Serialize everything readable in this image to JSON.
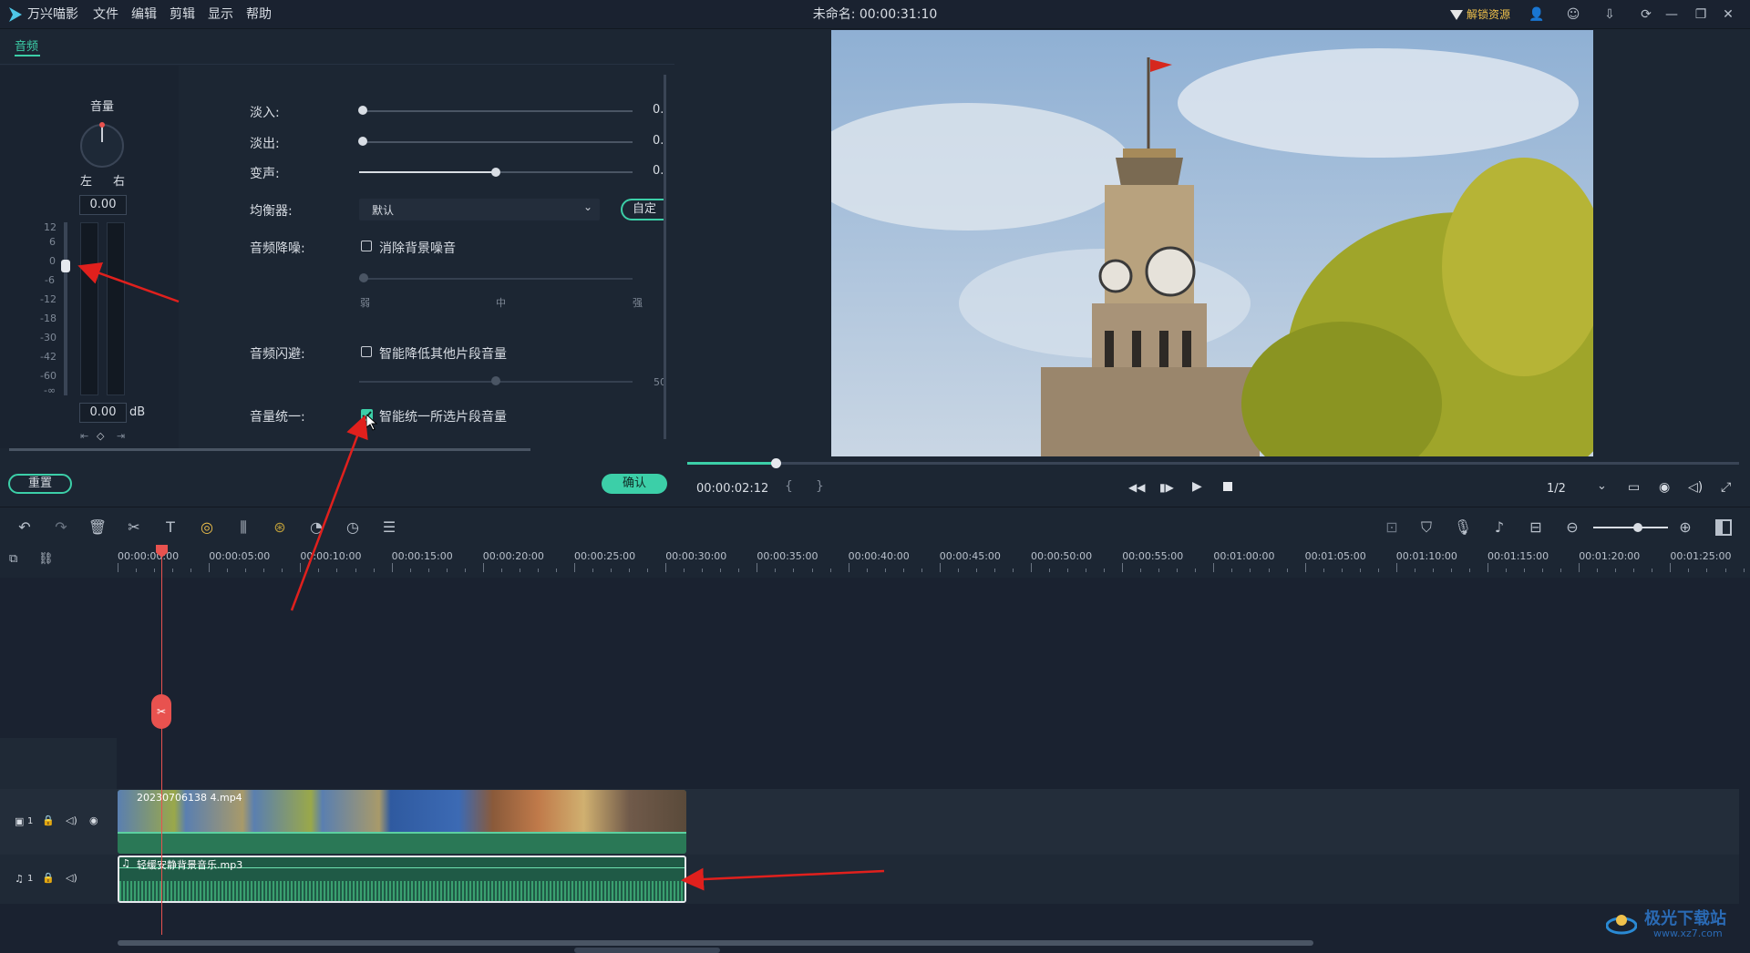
{
  "app": {
    "name": "万兴喵影",
    "title": "未命名: 00:00:31:10",
    "unlock_label": "解锁资源"
  },
  "menu": [
    "文件",
    "编辑",
    "剪辑",
    "显示",
    "帮助"
  ],
  "panel": {
    "tab": "音频",
    "volume_label": "音量",
    "left_label": "左",
    "right_label": "右",
    "pan_value": "0.00",
    "meter_scale": [
      "12",
      "6",
      "0",
      "-6",
      "-12",
      "-18",
      "-30",
      "-42",
      "-60",
      "-∞"
    ],
    "volume_value": "0.00",
    "db_unit": "dB",
    "fade_in_label": "淡入:",
    "fade_out_label": "淡出:",
    "pitch_label": "变声:",
    "eq_label": "均衡器:",
    "eq_value": "默认",
    "eq_custom": "自定",
    "denoise_label": "音频降噪:",
    "denoise_check": "消除背景噪音",
    "denoise_low": "弱",
    "denoise_mid": "中",
    "denoise_high": "强",
    "ducking_label": "音频闪避:",
    "ducking_check": "智能降低其他片段音量",
    "ducking_value": "50",
    "normalize_label": "音量统一:",
    "normalize_check": "智能统一所选片段音量",
    "normalize_checked": true,
    "value_truncated": "0.",
    "reset_button": "重置",
    "ok_button": "确认"
  },
  "preview": {
    "time": "00:00:02:12",
    "bracket_in": "{",
    "bracket_out": "}",
    "quality": "1/2",
    "progress": 0.084
  },
  "ruler": [
    "00:00:00:00",
    "00:00:05:00",
    "00:00:10:00",
    "00:00:15:00",
    "00:00:20:00",
    "00:00:25:00",
    "00:00:30:00",
    "00:00:35:00",
    "00:00:40:00",
    "00:00:45:00",
    "00:00:50:00",
    "00:00:55:00",
    "00:01:00:00",
    "00:01:05:00",
    "00:01:10:00",
    "00:01:15:00",
    "00:01:20:00",
    "00:01:25:00"
  ],
  "tracks": {
    "video_track_no": "1",
    "audio_track_no": "1",
    "video_clip": "20230706138 4.mp4",
    "audio_clip": "轻缓安静背景音乐.mp3"
  },
  "watermark": {
    "line1": "极光下载站",
    "line2": "www.xz7.com"
  },
  "colors": {
    "accent": "#3ccfa8",
    "playhead": "#e8524f",
    "arrow": "#e0201d"
  }
}
